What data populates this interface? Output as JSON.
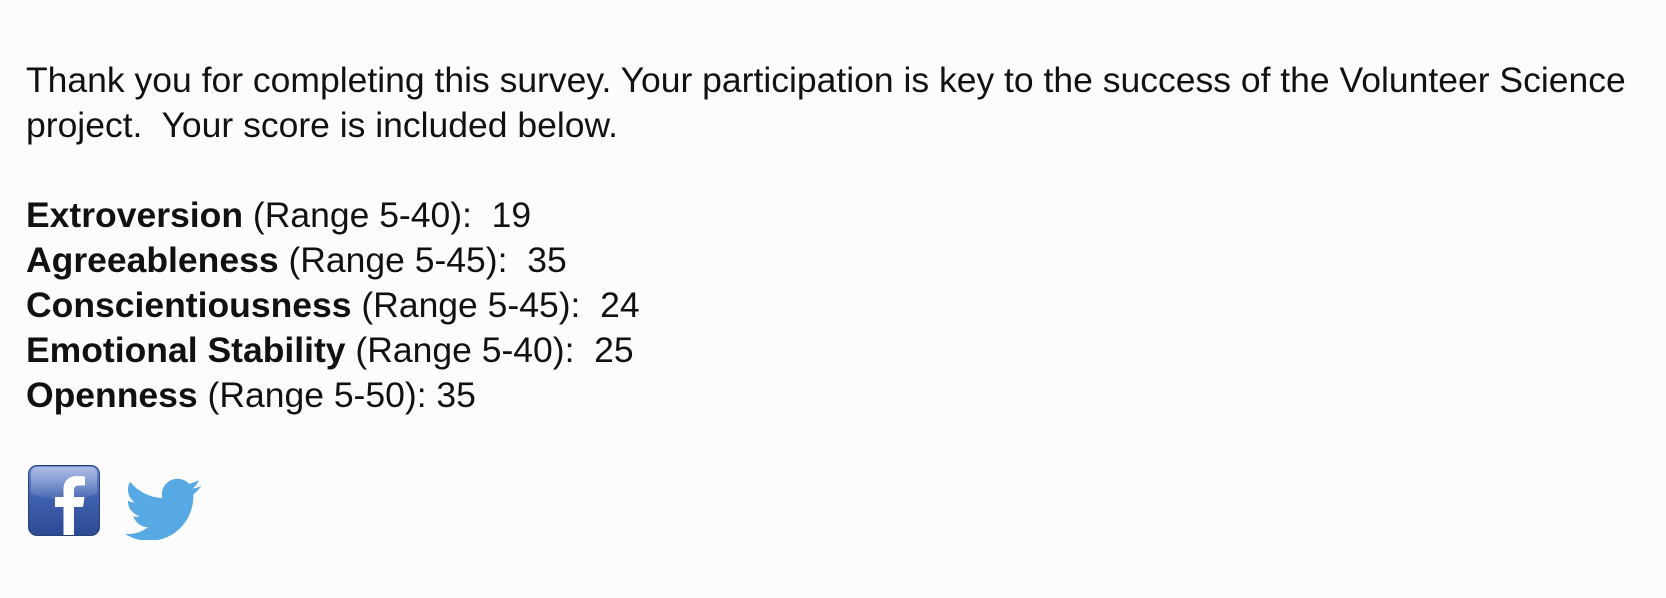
{
  "intro": {
    "text": "Thank you for completing this survey. Your participation is key to the success of the Volunteer Science project.  Your score is included below."
  },
  "scores": [
    {
      "trait": "Extroversion",
      "range": " (Range 5-40):  ",
      "score": "19"
    },
    {
      "trait": "Agreeableness",
      "range": " (Range 5-45):  ",
      "score": "35"
    },
    {
      "trait": "Conscientiousness",
      "range": " (Range 5-45):  ",
      "score": "24"
    },
    {
      "trait": "Emotional Stability",
      "range": " (Range 5-40):  ",
      "score": "25"
    },
    {
      "trait": "Openness",
      "range": " (Range 5-50): ",
      "score": "35"
    }
  ],
  "social": {
    "facebook_icon": "facebook-icon",
    "twitter_icon": "twitter-icon",
    "facebook_color": "#3b5ba8",
    "twitter_color": "#55a9e3"
  }
}
